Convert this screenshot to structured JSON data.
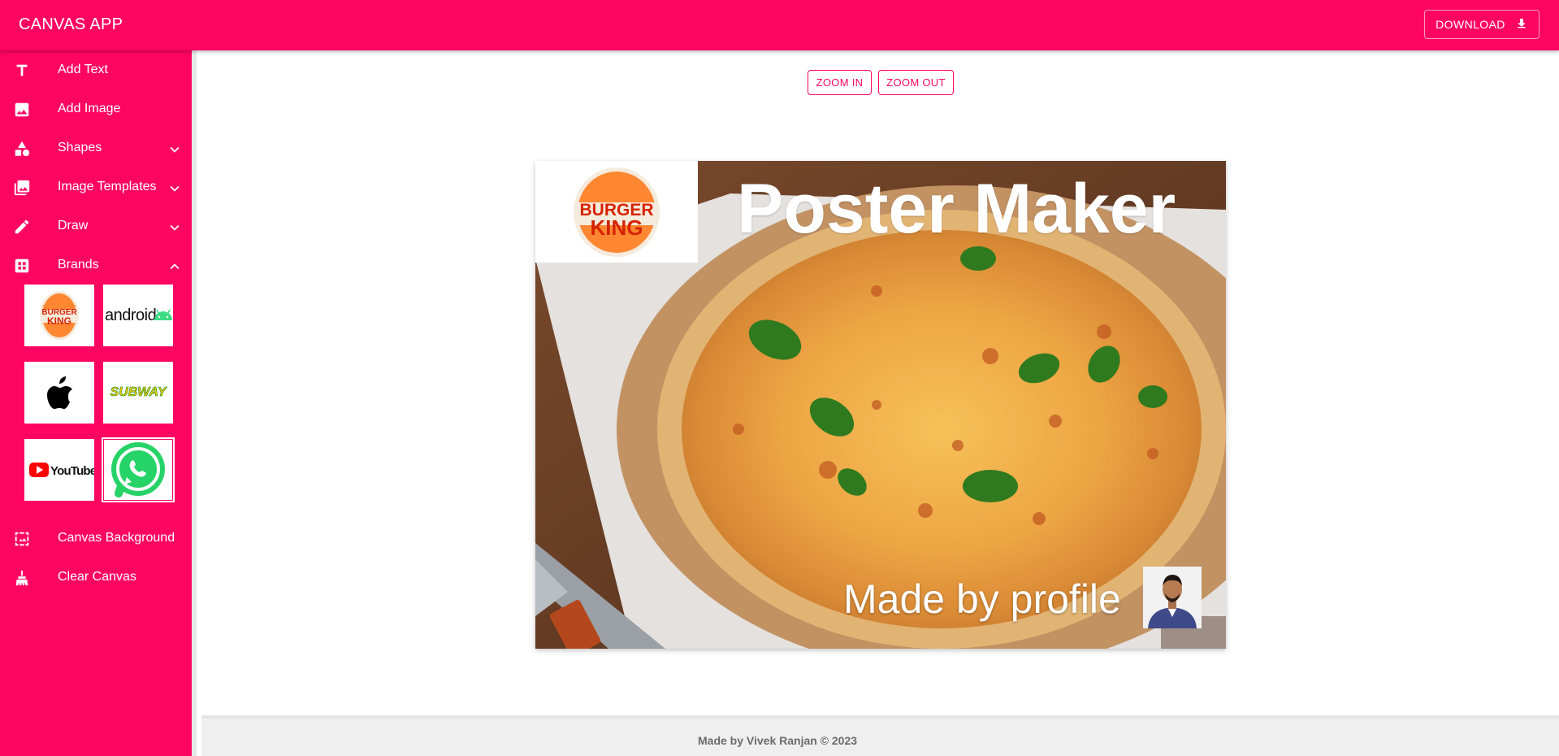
{
  "app": {
    "title": "CANVAS APP"
  },
  "header": {
    "download_label": "DOWNLOAD",
    "download_icon": "download-icon"
  },
  "sidebar": {
    "items": [
      {
        "label": "Add Text",
        "icon": "text-icon"
      },
      {
        "label": "Add Image",
        "icon": "image-icon"
      },
      {
        "label": "Shapes",
        "icon": "shapes-icon",
        "expandable": true,
        "expanded": false
      },
      {
        "label": "Image Templates",
        "icon": "photo-library-icon",
        "expandable": true,
        "expanded": false
      },
      {
        "label": "Draw",
        "icon": "draw-icon",
        "expandable": true,
        "expanded": false
      },
      {
        "label": "Brands",
        "icon": "brands-icon",
        "expandable": true,
        "expanded": true
      },
      {
        "label": "Canvas Background",
        "icon": "background-icon"
      },
      {
        "label": "Clear Canvas",
        "icon": "broom-icon"
      }
    ],
    "brands": [
      {
        "name": "burger-king",
        "logo_text_top": "BURGER",
        "logo_text_bottom": "KING"
      },
      {
        "name": "android",
        "logo_text": "android"
      },
      {
        "name": "apple"
      },
      {
        "name": "subway",
        "logo_text": "SUBWAY"
      },
      {
        "name": "youtube",
        "logo_text": "YouTube"
      },
      {
        "name": "whatsapp",
        "selected": true
      }
    ]
  },
  "toolbar": {
    "zoom_in_label": "ZOOM IN",
    "zoom_out_label": "ZOOM OUT"
  },
  "canvas": {
    "title": "Poster Maker",
    "made_by": "Made by profile",
    "logo_text_top": "BURGER",
    "logo_text_bottom": "KING"
  },
  "footer": {
    "text": "Made by Vivek Ranjan © 2023"
  },
  "colors": {
    "accent": "#ff0562",
    "footer_bg": "#efefef"
  }
}
